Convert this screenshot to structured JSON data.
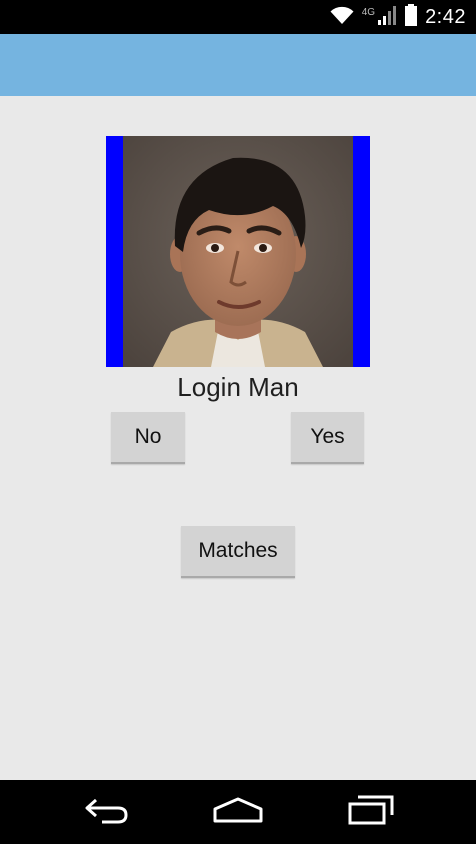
{
  "status_bar": {
    "time": "2:42",
    "network_label": "4G",
    "icons": [
      "wifi-icon",
      "signal-icon",
      "battery-icon"
    ]
  },
  "colors": {
    "action_bar": "#75b4e0",
    "content_background": "#e9e9e9",
    "photo_frame": "#0000ff",
    "button_background": "#d3d3d3"
  },
  "profile": {
    "name": "Login Man"
  },
  "buttons": {
    "no_label": "No",
    "yes_label": "Yes",
    "matches_label": "Matches"
  },
  "nav_bar": {
    "icons": [
      "back-icon",
      "home-icon",
      "recents-icon"
    ]
  }
}
